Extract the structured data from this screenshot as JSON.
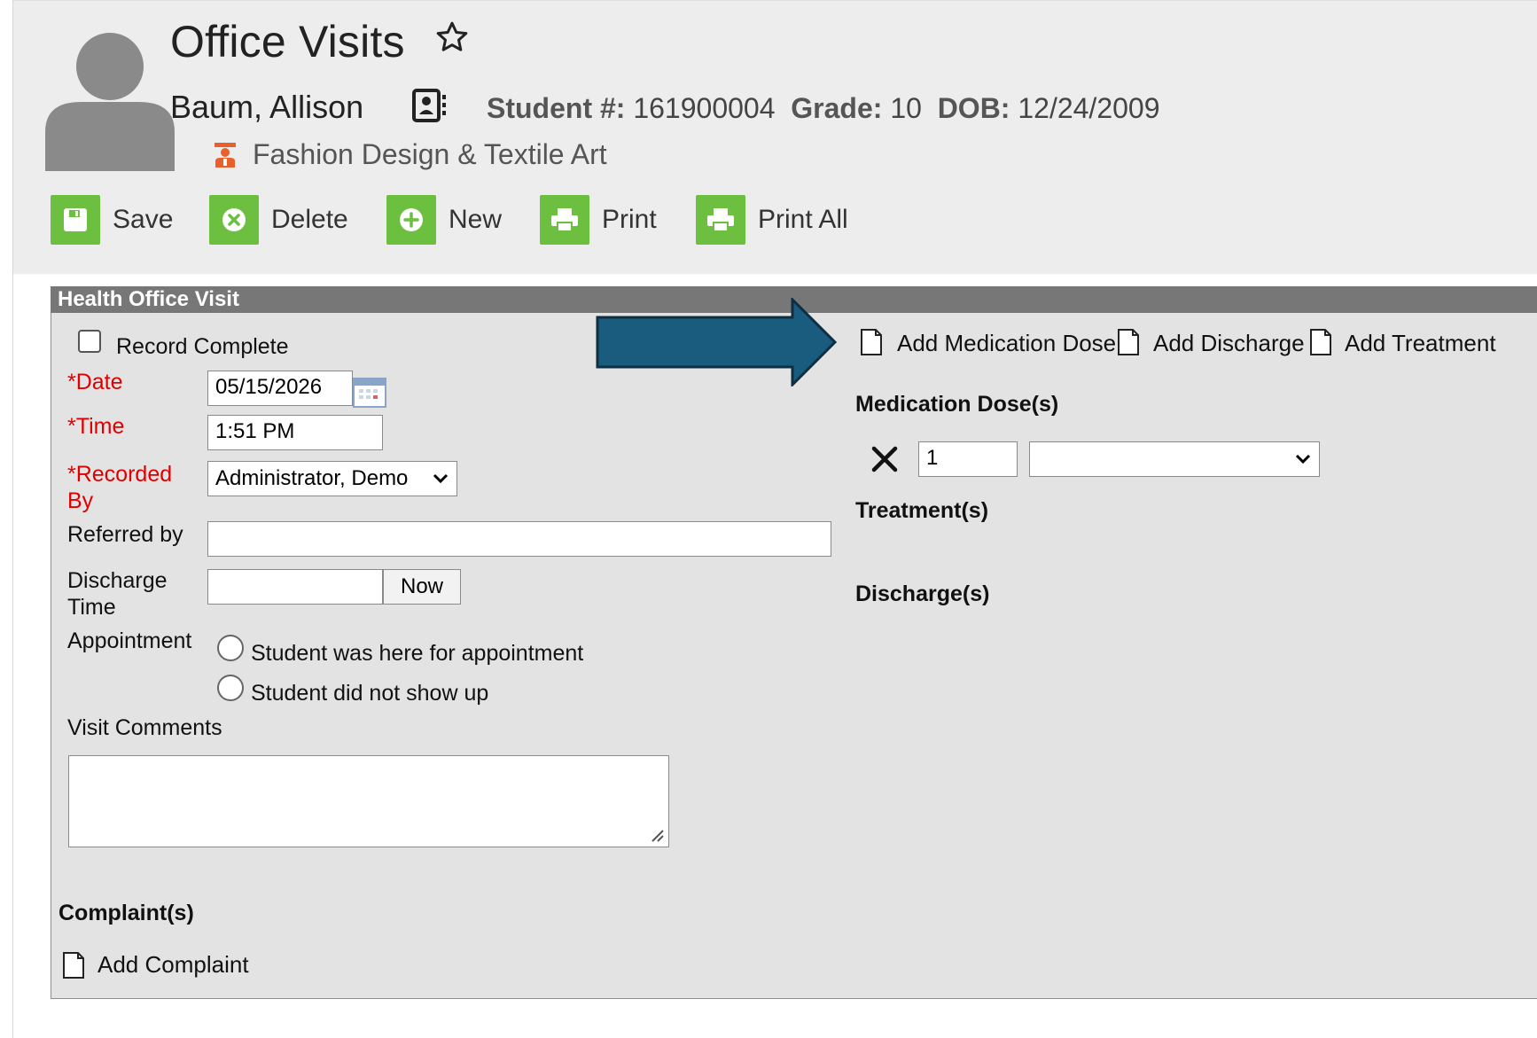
{
  "header": {
    "title": "Office Visits",
    "student_name": "Baum, Allison",
    "student_number_label": "Student #:",
    "student_number": "161900004",
    "grade_label": "Grade:",
    "grade": "10",
    "dob_label": "DOB:",
    "dob": "12/24/2009",
    "program": "Fashion Design & Textile Art"
  },
  "toolbar": {
    "save_label": "Save",
    "delete_label": "Delete",
    "new_label": "New",
    "print_label": "Print",
    "print_all_label": "Print All"
  },
  "panel": {
    "title": "Health Office Visit",
    "record_complete_label": "Record Complete",
    "date_label": "*Date",
    "date_value": "05/15/2026",
    "time_label": "*Time",
    "time_value": "1:51 PM",
    "recorded_by_label_1": "*Recorded",
    "recorded_by_label_2": "By",
    "recorded_by_value": "Administrator, Demo",
    "referred_by_label": "Referred by",
    "referred_by_value": "",
    "discharge_time_label_1": "Discharge",
    "discharge_time_label_2": "Time",
    "discharge_time_value": "",
    "now_button": "Now",
    "appointment_label": "Appointment",
    "appointment_options": [
      "Student was here for appointment",
      "Student did not show up"
    ],
    "visit_comments_label": "Visit Comments",
    "visit_comments_value": "",
    "complaints_heading": "Complaint(s)",
    "add_complaint": "Add Complaint",
    "add_medication_dose": "Add Medication Dose",
    "add_discharge": "Add Discharge",
    "add_treatment": "Add Treatment",
    "medication_heading": "Medication Dose(s)",
    "medication_qty": "1",
    "medication_select": "",
    "treatment_heading": "Treatment(s)",
    "discharge_heading": "Discharge(s)"
  },
  "colors": {
    "toolbar_icon": "#6cbf3f",
    "panel_header": "#777777",
    "required_label": "#e00000",
    "arrow_fill": "#1a5c7e",
    "program_icon": "#e8602c"
  },
  "icons": [
    "avatar-icon",
    "star-icon",
    "contact-card-icon",
    "program-icon",
    "save-icon",
    "delete-icon",
    "new-icon",
    "print-icon",
    "calendar-icon",
    "document-icon",
    "remove-x-icon",
    "callout-arrow"
  ]
}
